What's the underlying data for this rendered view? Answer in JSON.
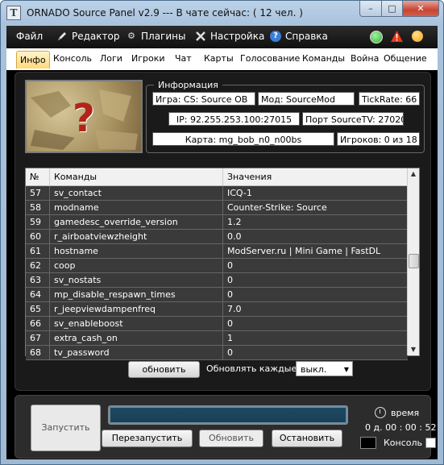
{
  "window": {
    "title": "ORNADO Source Panel v2.9 --- В чате сейчас: ( 12 чел. )",
    "icon_letter": "T",
    "controls": {
      "minimize": "–",
      "maximize": "□",
      "close": "✕"
    }
  },
  "menu": [
    {
      "label": "Файл",
      "icon": ""
    },
    {
      "label": "Редактор",
      "icon": "editor-icon"
    },
    {
      "label": "Плагины",
      "icon": "plugins-gear-icon"
    },
    {
      "label": "Настройка",
      "icon": "settings-tools-icon"
    },
    {
      "label": "Справка",
      "icon": "help-icon"
    }
  ],
  "status_icons": [
    {
      "name": "online-status-icon",
      "color": "#2fb52f"
    },
    {
      "name": "warning-icon",
      "color": "#e23a1a"
    },
    {
      "name": "notification-icon",
      "color": "#f3a01c"
    }
  ],
  "tabs": [
    "Инфо",
    "Консоль",
    "Логи",
    "Игроки",
    "Чат",
    "Карты",
    "Голосование",
    "Команды",
    "Война",
    "Общение"
  ],
  "active_tab": "Инфо",
  "info": {
    "legend": "Информация",
    "game": "Игра: CS: Source OB",
    "mod": "Мод: SourceMod",
    "tickrate": "TickRate: 66",
    "ip": "IP: 92.255.253.100:27015",
    "sourcetv": "Порт SourceTV:  27020",
    "map": "Карта: mg_bob_n0_n00bs",
    "players": "Игроков: 0 из 18"
  },
  "table": {
    "headers": [
      "№",
      "Команды",
      "Значения"
    ],
    "rows": [
      [
        "57",
        "sv_contact",
        "ICQ-1"
      ],
      [
        "58",
        "modname",
        "Counter-Strike: Source"
      ],
      [
        "59",
        "gamedesc_override_version",
        "1.2"
      ],
      [
        "60",
        "r_airboatviewzheight",
        "0.0"
      ],
      [
        "61",
        "hostname",
        "ModServer.ru | Mini Game | FastDL"
      ],
      [
        "62",
        "coop",
        "0"
      ],
      [
        "63",
        "sv_nostats",
        "0"
      ],
      [
        "64",
        "mp_disable_respawn_times",
        "0"
      ],
      [
        "65",
        "r_jeepviewdampenfreq",
        "7.0"
      ],
      [
        "66",
        "sv_enableboost",
        "0"
      ],
      [
        "67",
        "extra_cash_on",
        "1"
      ],
      [
        "68",
        "tv_password",
        "0"
      ]
    ]
  },
  "refresh": {
    "button": "обновить",
    "every_label": "Обновлять каждые:",
    "every_value": "выкл."
  },
  "controls": {
    "launch": "Запустить",
    "restart": "Перезапустить",
    "update": "Обновить",
    "stop": "Остановить",
    "time_label": "время",
    "time_value": "0 д.   00 : 00 : 52",
    "console_label": "Консоль"
  }
}
